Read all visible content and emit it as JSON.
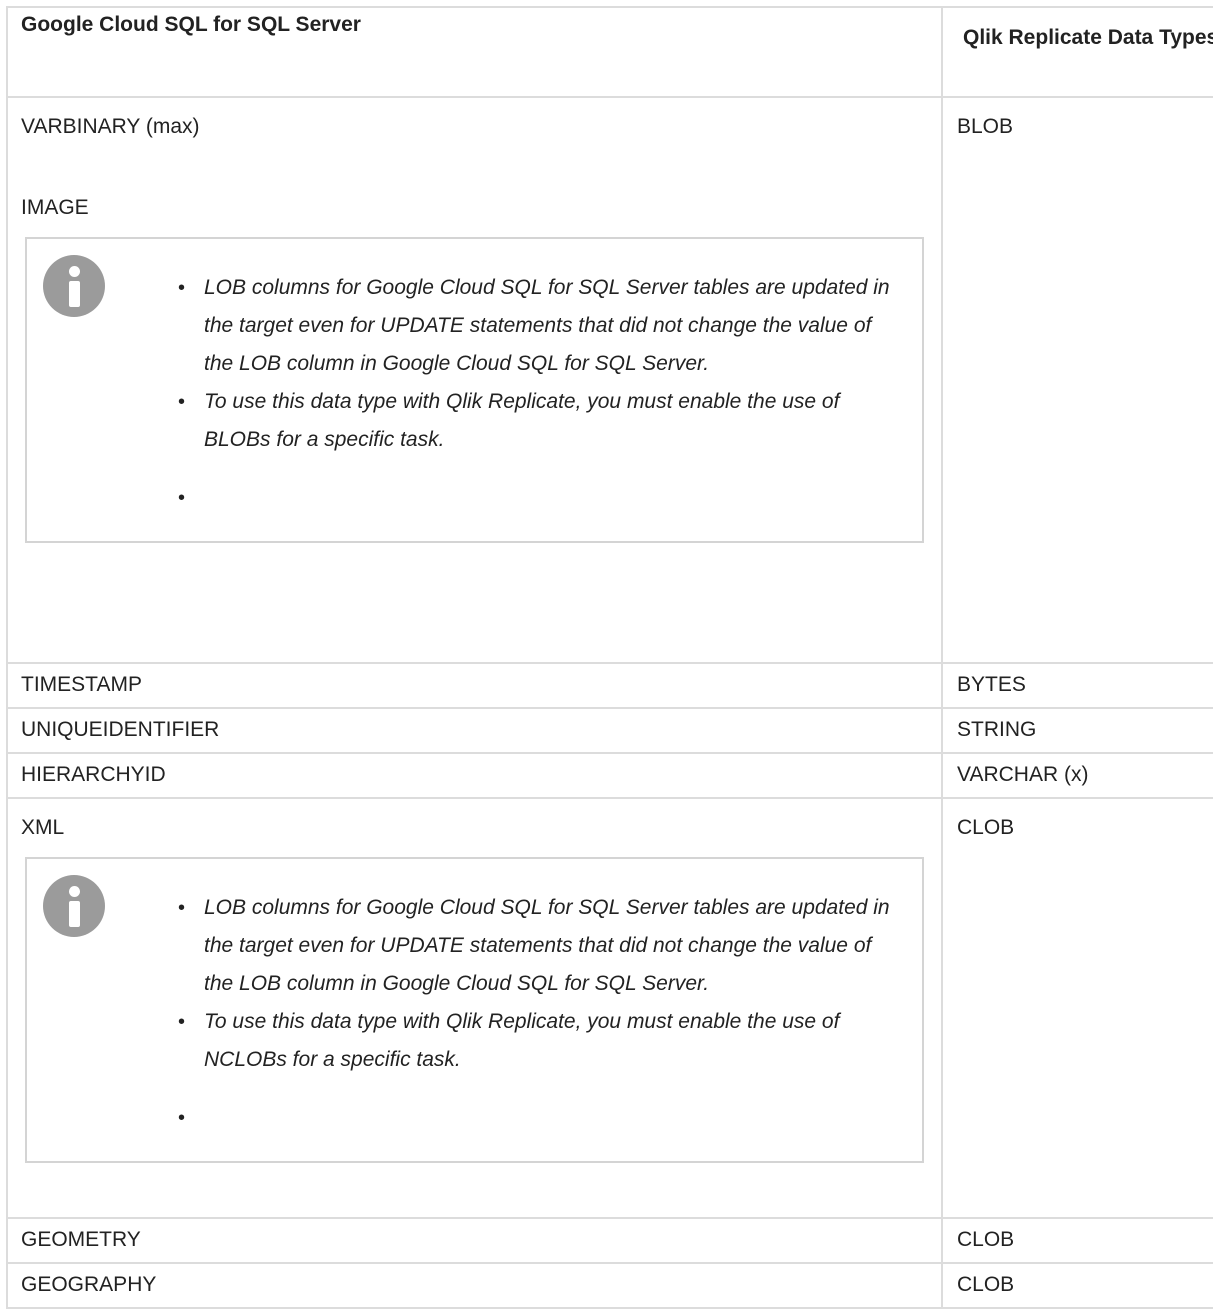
{
  "header": {
    "col1": "Google Cloud SQL for SQL Server",
    "col2": "Qlik Replicate Data Types"
  },
  "rows": {
    "blob": {
      "lines": [
        "VARBINARY (max)",
        "IMAGE"
      ],
      "target": "BLOB",
      "note": [
        "LOB columns for Google Cloud SQL for SQL Server tables are updated in the target even for UPDATE statements that did not change the value of the LOB column in Google Cloud SQL for SQL Server.",
        "To use this data type with Qlik Replicate, you must enable the use of BLOBs for a specific task.",
        ""
      ]
    },
    "timestamp": {
      "source": "TIMESTAMP",
      "target": "BYTES"
    },
    "uniqueidentifier": {
      "source": "UNIQUEIDENTIFIER",
      "target": "STRING"
    },
    "hierarchyid": {
      "source": "HIERARCHYID",
      "target": "VARCHAR (x)"
    },
    "xml": {
      "source": "XML",
      "target": "CLOB",
      "note": [
        "LOB columns for Google Cloud SQL for SQL Server tables are updated in the target even for UPDATE statements that did not change the value of the LOB column in Google Cloud SQL for SQL Server.",
        "To use this data type with Qlik Replicate, you must enable the use of NCLOBs for a specific task.",
        ""
      ]
    },
    "geometry": {
      "source": "GEOMETRY",
      "target": "CLOB"
    },
    "geography": {
      "source": "GEOGRAPHY",
      "target": "CLOB"
    }
  }
}
